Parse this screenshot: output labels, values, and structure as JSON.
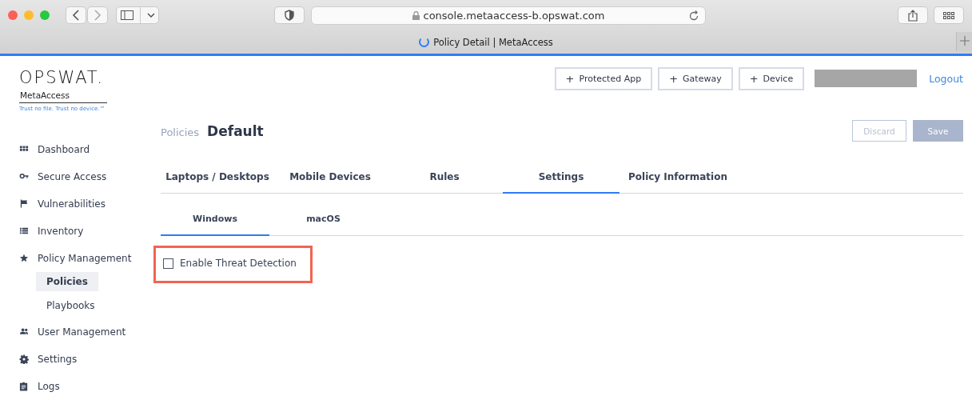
{
  "browser": {
    "url": "console.metaaccess-b.opswat.com",
    "tab_title": "Policy Detail | MetaAccess",
    "loading": true
  },
  "logo": {
    "brand": "OPSWAT.",
    "product": "MetaAccess",
    "tagline": "Trust no file. Trust no device.™"
  },
  "header": {
    "buttons": [
      {
        "icon": "+",
        "label": "Protected App"
      },
      {
        "icon": "+",
        "label": "Gateway"
      },
      {
        "icon": "+",
        "label": "Device"
      }
    ],
    "logout": "Logout"
  },
  "sidebar": {
    "items": [
      {
        "label": "Dashboard",
        "kind": "grid",
        "selected": false
      },
      {
        "label": "Secure Access",
        "kind": "key",
        "selected": false
      },
      {
        "label": "Vulnerabilities",
        "kind": "flag",
        "selected": false
      },
      {
        "label": "Inventory",
        "kind": "list",
        "selected": false
      },
      {
        "label": "Policy Management",
        "kind": "star",
        "selected": false,
        "children": [
          {
            "label": "Policies",
            "selected": true
          },
          {
            "label": "Playbooks",
            "selected": false
          }
        ]
      },
      {
        "label": "User Management",
        "kind": "people",
        "selected": false
      },
      {
        "label": "Settings",
        "kind": "gear",
        "selected": false
      },
      {
        "label": "Logs",
        "kind": "clipboard",
        "selected": false
      }
    ]
  },
  "page": {
    "breadcrumb": "Policies",
    "title": "Default",
    "actions": [
      {
        "label": "Discard",
        "kind": "outline",
        "disabled": true
      },
      {
        "label": "Save",
        "kind": "filled",
        "disabled": true
      }
    ]
  },
  "tabs": [
    {
      "label": "Laptops / Desktops",
      "selected": false
    },
    {
      "label": "Mobile Devices",
      "selected": false
    },
    {
      "label": "Rules",
      "selected": false
    },
    {
      "label": "Settings",
      "selected": true
    },
    {
      "label": "Policy Information",
      "selected": false
    }
  ],
  "subtabs": [
    {
      "label": "Windows",
      "selected": true
    },
    {
      "label": "macOS",
      "selected": false
    }
  ],
  "options": [
    {
      "label": "Enable Threat Detection",
      "checked": false,
      "highlighted": true
    }
  ]
}
